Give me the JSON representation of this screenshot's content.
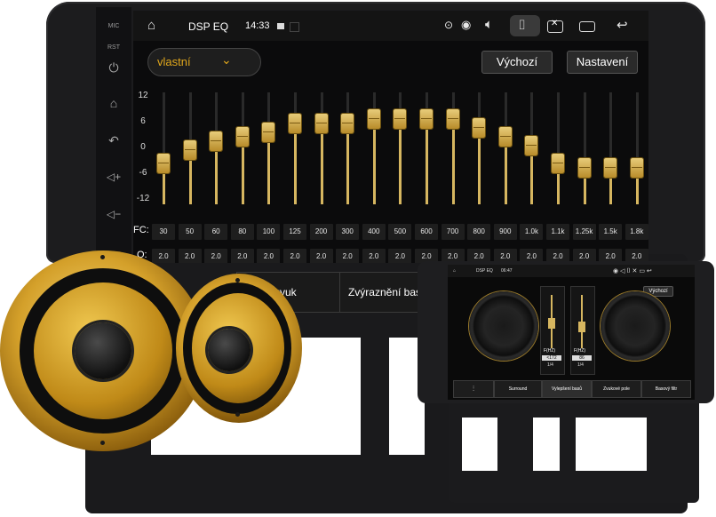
{
  "side": {
    "mic_label": "MIC",
    "rst_label": "RST",
    "icons": [
      "power-icon",
      "home-icon",
      "back-icon",
      "volume-up-icon",
      "volume-down-icon"
    ]
  },
  "status_bar": {
    "app_title": "DSP EQ",
    "time": "14:33",
    "icons": [
      "home-icon",
      "gallery-icon",
      "location-icon",
      "wifi-icon",
      "volume-icon",
      "camera-icon",
      "close-box-icon",
      "recents-icon",
      "back-icon"
    ]
  },
  "preset": {
    "selected": "vlastní"
  },
  "buttons": {
    "default": "Výchozí",
    "settings": "Nastavení"
  },
  "eq": {
    "axis_labels": [
      "12",
      "6",
      "0",
      "-6",
      "-12"
    ],
    "fc_label": "FC:",
    "q_label": "Q:",
    "frequencies": [
      "30",
      "50",
      "60",
      "80",
      "100",
      "125",
      "200",
      "300",
      "400",
      "500",
      "600",
      "700",
      "800",
      "900",
      "1.0k",
      "1.1k",
      "1.25k",
      "1.5k",
      "1.8k"
    ],
    "q_values": [
      "2.0",
      "2.0",
      "2.0",
      "2.0",
      "2.0",
      "2.0",
      "2.0",
      "2.0",
      "2.0",
      "2.0",
      "2.0",
      "2.0",
      "2.0",
      "2.0",
      "2.0",
      "2.0",
      "2.0",
      "2.0",
      "2.0"
    ],
    "gain_db": [
      -4,
      -1,
      1,
      2,
      3,
      5,
      5,
      5,
      6,
      6,
      6,
      6,
      4,
      2,
      0,
      -4,
      -5,
      -5,
      -5
    ]
  },
  "tabs": [
    "torový zvuk",
    "Zvýraznění bas"
  ],
  "mini": {
    "app_title": "DSP EQ",
    "time": "06:47",
    "button": "Výchozí",
    "tabs": [
      "Surround",
      "Vylepšení basů",
      "Zvukové pole",
      "Basový filtr"
    ],
    "readouts_left": [
      "F(HZ)",
      "<172",
      "1/4"
    ],
    "readouts_right": [
      "F(HZ)",
      "86",
      "1/4"
    ]
  },
  "colors": {
    "accent": "#e0a71c",
    "gold_slider": "#d6b660",
    "screen_bg": "#0b0b0c"
  }
}
